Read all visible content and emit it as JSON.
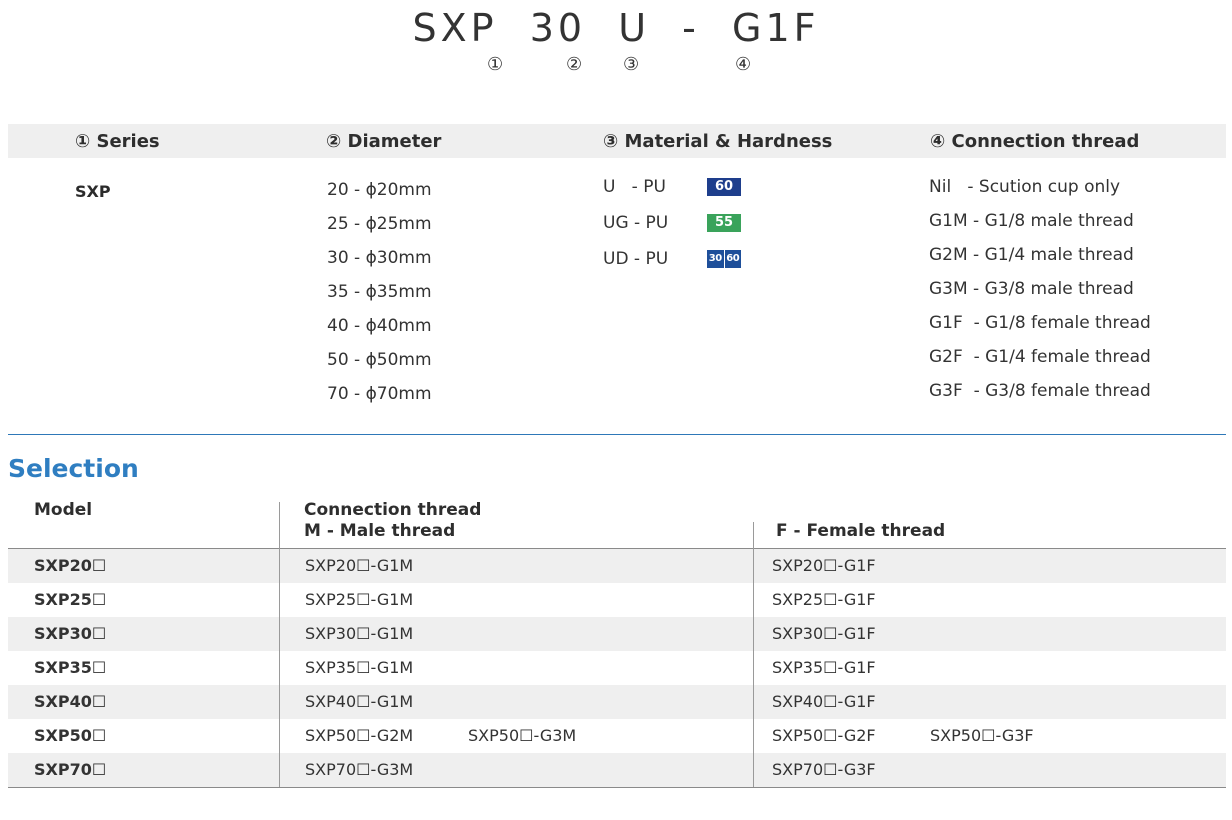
{
  "header": {
    "code": "SXP  30  U  -  G1F",
    "markers": [
      "①",
      "②",
      "③",
      "④"
    ]
  },
  "spec": {
    "headers": [
      "① Series",
      "② Diameter",
      "③ Material & Hardness",
      "④ Connection thread"
    ],
    "series": "SXP",
    "diameters": [
      "20 - ϕ20mm",
      "25 - ϕ25mm",
      "30 - ϕ30mm",
      "35 - ϕ35mm",
      "40 - ϕ40mm",
      "50 - ϕ50mm",
      "70 - ϕ70mm"
    ],
    "materials": [
      {
        "label": "U   - PU",
        "badge": "60",
        "color": "#1e3e8c"
      },
      {
        "label": "UG - PU",
        "badge": "55",
        "color": "#3aa35b"
      },
      {
        "label": "UD - PU",
        "badge_a": "30",
        "badge_b": "60",
        "color": "#1e4f9a"
      }
    ],
    "threads": [
      "Nil   - Scution cup only",
      "G1M - G1/8 male thread",
      "G2M - G1/4 male thread",
      "G3M - G3/8 male thread",
      "G1F  - G1/8 female thread",
      "G2F  - G1/4 female thread",
      "G3F  - G3/8 female thread"
    ]
  },
  "selection": {
    "title": "Selection",
    "headers": {
      "model": "Model",
      "connection": "Connection thread",
      "male": "M - Male thread",
      "female": "F - Female thread"
    },
    "rows": [
      {
        "model": "SXP20☐",
        "male": [
          "SXP20☐-G1M"
        ],
        "female": [
          "SXP20☐-G1F"
        ]
      },
      {
        "model": "SXP25☐",
        "male": [
          "SXP25☐-G1M"
        ],
        "female": [
          "SXP25☐-G1F"
        ]
      },
      {
        "model": "SXP30☐",
        "male": [
          "SXP30☐-G1M"
        ],
        "female": [
          "SXP30☐-G1F"
        ]
      },
      {
        "model": "SXP35☐",
        "male": [
          "SXP35☐-G1M"
        ],
        "female": [
          "SXP35☐-G1F"
        ]
      },
      {
        "model": "SXP40☐",
        "male": [
          "SXP40☐-G1M"
        ],
        "female": [
          "SXP40☐-G1F"
        ]
      },
      {
        "model": "SXP50☐",
        "male": [
          "SXP50☐-G2M",
          "SXP50☐-G3M"
        ],
        "female": [
          "SXP50☐-G2F",
          "SXP50☐-G3F"
        ]
      },
      {
        "model": "SXP70☐",
        "male": [
          "SXP70☐-G3M"
        ],
        "female": [
          "SXP70☐-G3F"
        ]
      }
    ]
  }
}
